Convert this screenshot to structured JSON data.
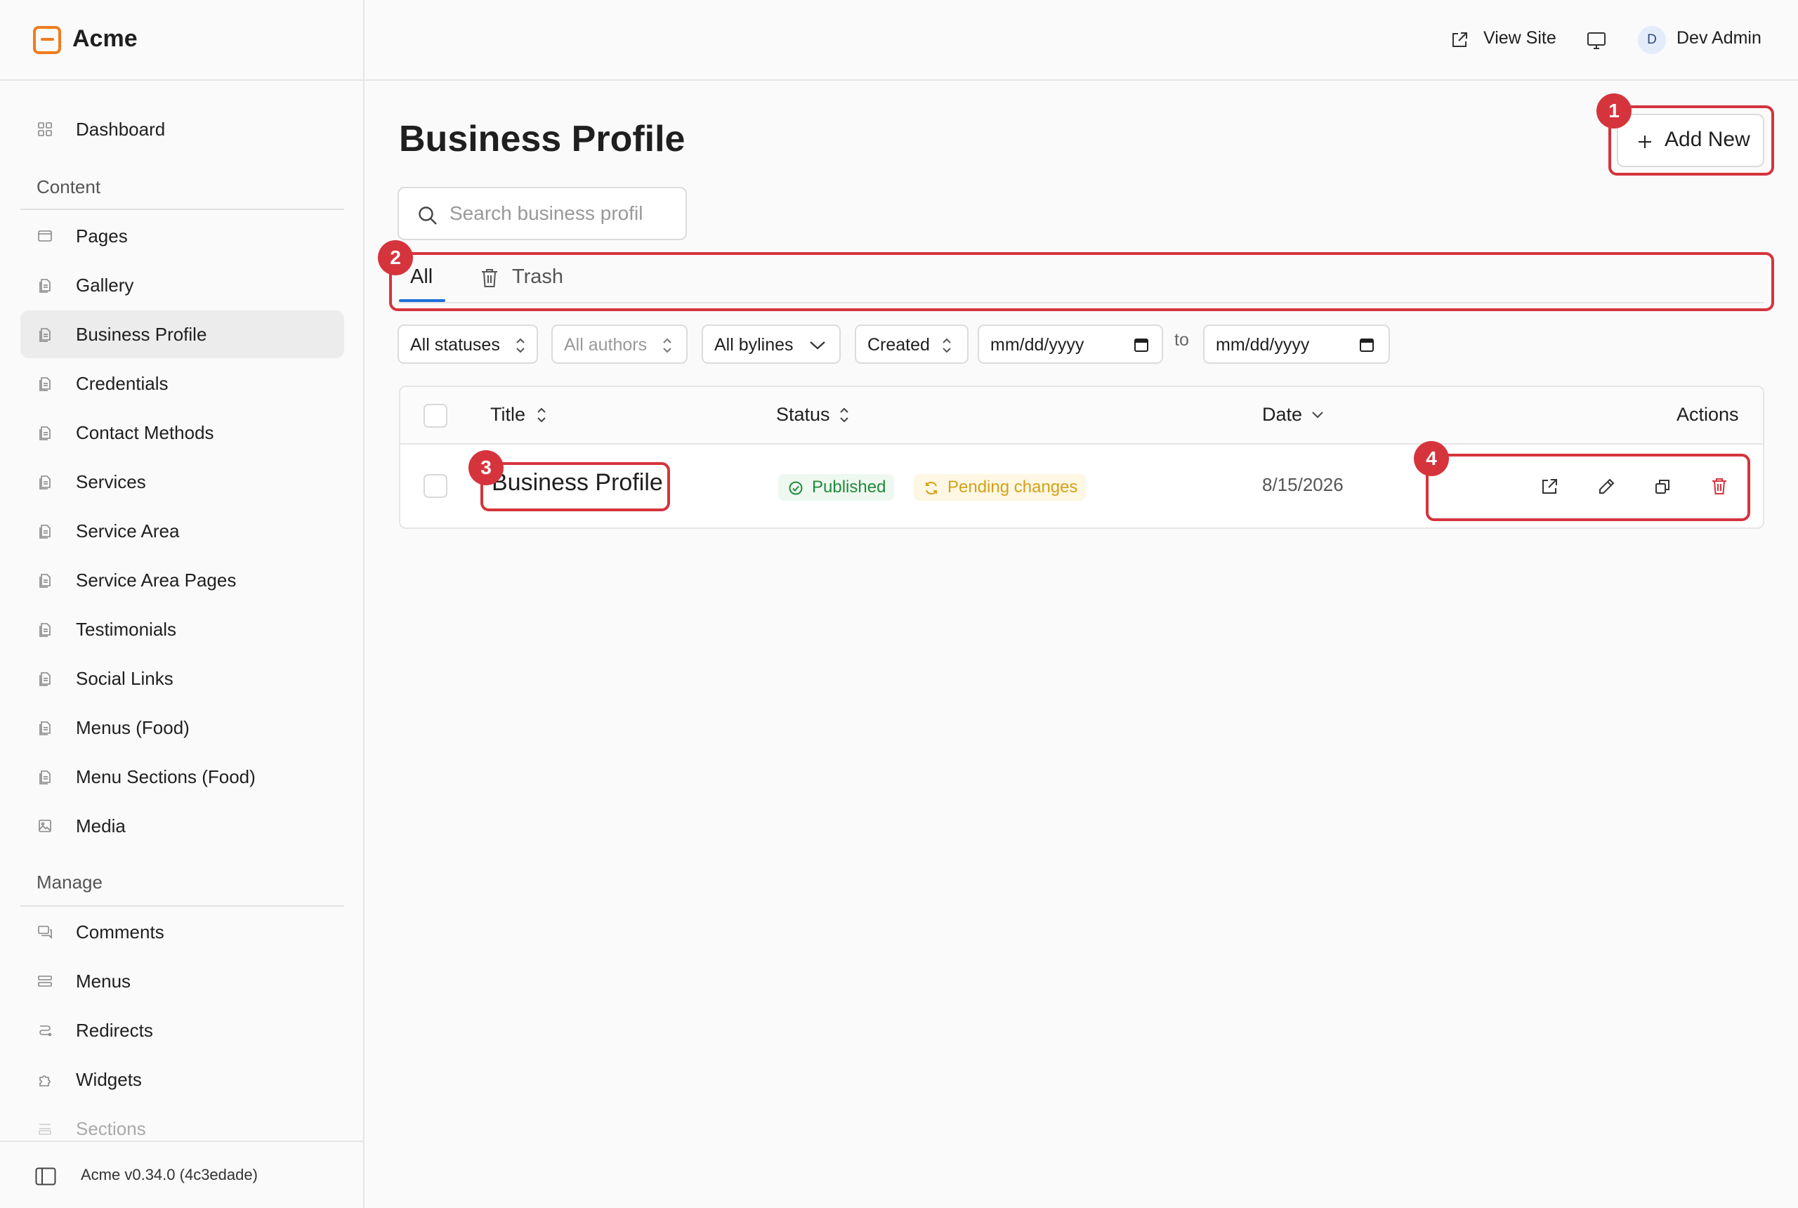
{
  "brand": {
    "name": "Acme",
    "accent": "#f07c1e"
  },
  "topbar": {
    "view_site": "View Site",
    "avatar_initial": "D",
    "user_name": "Dev Admin"
  },
  "sidebar": {
    "dashboard": "Dashboard",
    "content_label": "Content",
    "content_items": [
      {
        "label": "Pages",
        "icon": "page-icon"
      },
      {
        "label": "Gallery",
        "icon": "document-icon"
      },
      {
        "label": "Business Profile",
        "icon": "document-icon",
        "active": true
      },
      {
        "label": "Credentials",
        "icon": "document-icon"
      },
      {
        "label": "Contact Methods",
        "icon": "document-icon"
      },
      {
        "label": "Services",
        "icon": "document-icon"
      },
      {
        "label": "Service Area",
        "icon": "document-icon"
      },
      {
        "label": "Service Area Pages",
        "icon": "document-icon"
      },
      {
        "label": "Testimonials",
        "icon": "document-icon"
      },
      {
        "label": "Social Links",
        "icon": "document-icon"
      },
      {
        "label": "Menus (Food)",
        "icon": "document-icon"
      },
      {
        "label": "Menu Sections (Food)",
        "icon": "document-icon"
      },
      {
        "label": "Media",
        "icon": "image-icon"
      }
    ],
    "manage_label": "Manage",
    "manage_items": [
      {
        "label": "Comments",
        "icon": "comments-icon"
      },
      {
        "label": "Menus",
        "icon": "menus-icon"
      },
      {
        "label": "Redirects",
        "icon": "redirects-icon"
      },
      {
        "label": "Widgets",
        "icon": "puzzle-icon"
      },
      {
        "label": "Sections",
        "icon": "sections-icon"
      }
    ],
    "version": "Acme v0.34.0 (4c3edade)"
  },
  "main": {
    "title": "Business Profile",
    "add_new": "Add New",
    "search_placeholder": "Search business profil",
    "tabs": [
      {
        "label": "All",
        "active": true
      },
      {
        "label": "Trash"
      }
    ],
    "filters": {
      "status": "All statuses",
      "authors": "All authors",
      "bylines": "All bylines",
      "sort_field": "Created",
      "date_from": "mm/dd/yyyy",
      "to": "to",
      "date_to": "mm/dd/yyyy"
    },
    "table": {
      "columns": {
        "title": "Title",
        "status": "Status",
        "date": "Date",
        "actions": "Actions"
      },
      "rows": [
        {
          "title": "Business Profile",
          "status": "Published",
          "pending": "Pending changes",
          "date": "8/15/2026"
        }
      ]
    }
  },
  "callouts": [
    "1",
    "2",
    "3",
    "4"
  ],
  "colors": {
    "highlight": "#d5343d",
    "tab_active": "#1e6fd9",
    "published": "#218a3a",
    "pending": "#d4a219",
    "delete": "#d5343d"
  }
}
